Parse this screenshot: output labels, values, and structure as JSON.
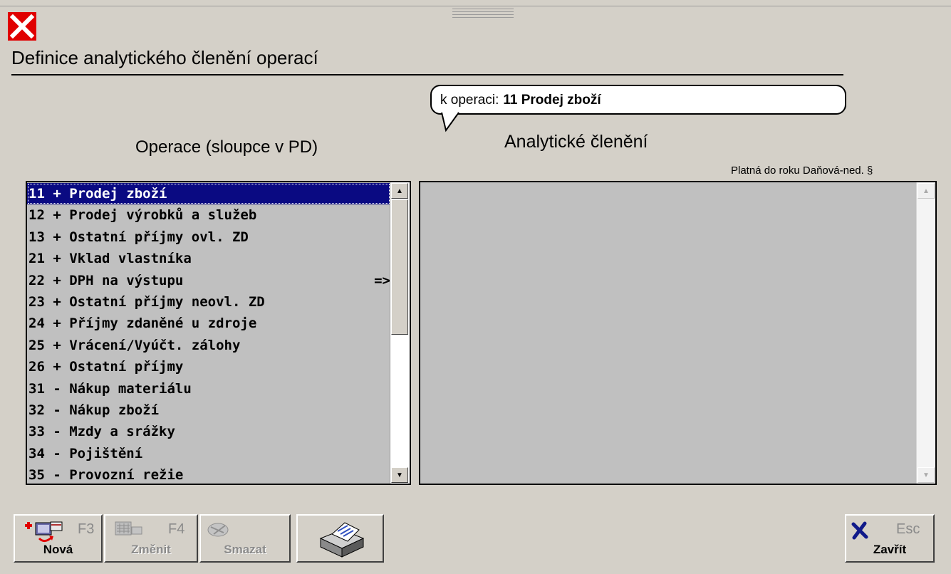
{
  "window": {
    "title": "Definice analytického členění operací",
    "close_icon": "close-icon"
  },
  "bubble": {
    "prefix": "k operaci:",
    "operation": "11  Prodej zboží"
  },
  "left": {
    "header": "Operace (sloupce v PD)",
    "arrow": "=>",
    "items": [
      "11 + Prodej zboží",
      "12 + Prodej výrobků a služeb",
      "13 + Ostatní příjmy ovl. ZD",
      "21 + Vklad vlastníka",
      "22 + DPH na výstupu",
      "23 + Ostatní příjmy neovl. ZD",
      "24 + Příjmy zdaněné u zdroje",
      "25 + Vrácení/Vyúčt. zálohy",
      "26 + Ostatní příjmy",
      "31 - Nákup materiálu",
      "32 - Nákup zboží",
      "33 - Mzdy a srážky",
      "34 - Pojištění",
      "35 - Provozní režie"
    ]
  },
  "right": {
    "header": "Analytické členění",
    "columns": "Platná do roku Daňová-ned. §"
  },
  "toolbar": {
    "new_label": "Nová",
    "new_key": "F3",
    "edit_label": "Změnit",
    "edit_key": "F4",
    "delete_label": "Smazat",
    "close_label": "Zavřít",
    "close_key": "Esc"
  },
  "colors": {
    "selection": "#0a0a82",
    "background": "#d4d0c8",
    "list_background": "#c0c0c0",
    "close": "#e00000"
  }
}
